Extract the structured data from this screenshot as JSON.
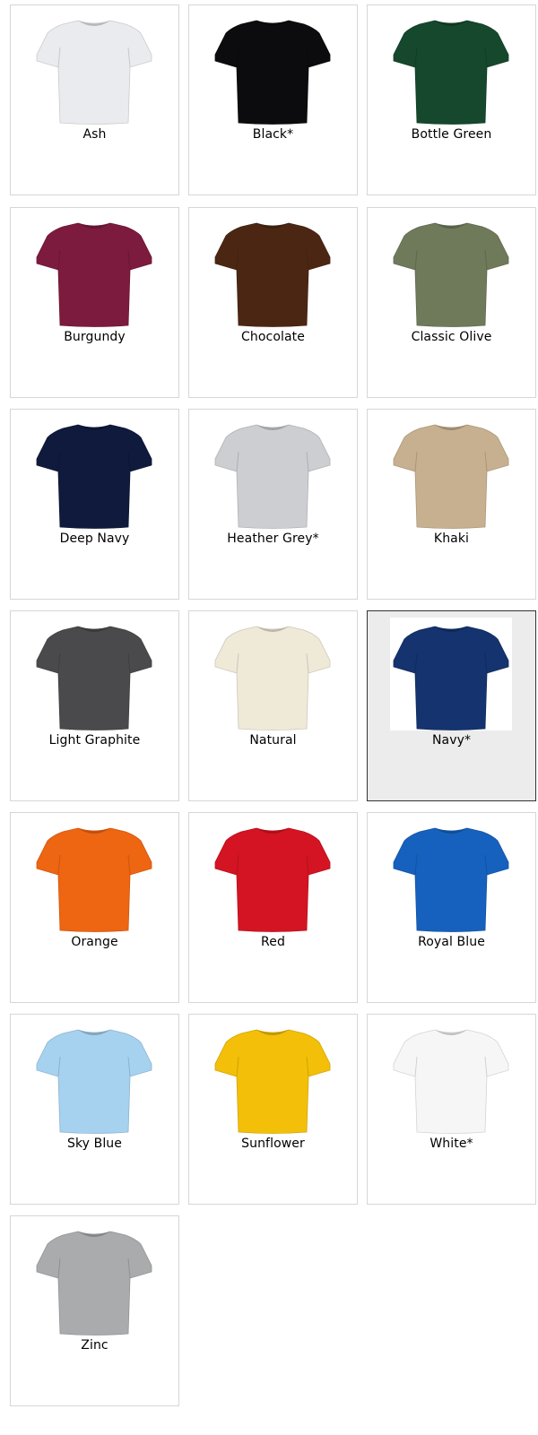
{
  "swatches": [
    {
      "label": "Ash",
      "color": "#eaebee",
      "selected": false
    },
    {
      "label": "Black*",
      "color": "#0c0c0e",
      "selected": false
    },
    {
      "label": "Bottle Green",
      "color": "#15482c",
      "selected": false
    },
    {
      "label": "Burgundy",
      "color": "#7c1b3d",
      "selected": false
    },
    {
      "label": "Chocolate",
      "color": "#4b2713",
      "selected": false
    },
    {
      "label": "Classic Olive",
      "color": "#6f7a5b",
      "selected": false
    },
    {
      "label": "Deep Navy",
      "color": "#0f1a3d",
      "selected": false
    },
    {
      "label": "Heather Grey*",
      "color": "#cdced2",
      "selected": false
    },
    {
      "label": "Khaki",
      "color": "#c7b08f",
      "selected": false
    },
    {
      "label": "Light Graphite",
      "color": "#4a4a4c",
      "selected": false
    },
    {
      "label": "Natural",
      "color": "#efe9d8",
      "selected": false
    },
    {
      "label": "Navy*",
      "color": "#14336f",
      "selected": true
    },
    {
      "label": "Orange",
      "color": "#ee6512",
      "selected": false
    },
    {
      "label": "Red",
      "color": "#d41422",
      "selected": false
    },
    {
      "label": "Royal Blue",
      "color": "#1661bd",
      "selected": false
    },
    {
      "label": "Sky Blue",
      "color": "#a6d1ef",
      "selected": false
    },
    {
      "label": "Sunflower",
      "color": "#f3bf08",
      "selected": false
    },
    {
      "label": "White*",
      "color": "#f6f6f6",
      "selected": false
    },
    {
      "label": "Zinc",
      "color": "#a9abac",
      "selected": false
    }
  ],
  "icons": {
    "product": "tshirt-icon"
  }
}
